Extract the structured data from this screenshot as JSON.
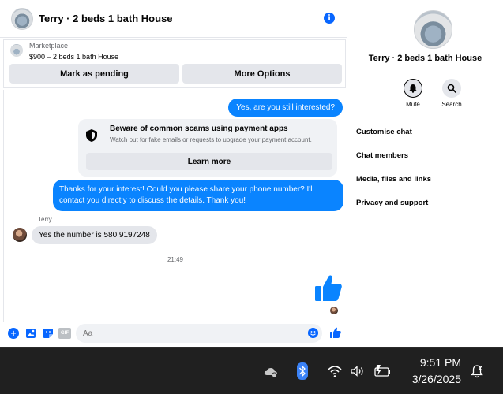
{
  "header": {
    "title": "Terry · 2 beds 1 bath House",
    "info_icon": "info-icon"
  },
  "marketplace": {
    "label": "Marketplace",
    "price_title": "$900 – 2 beds 1 bath House",
    "pending_button": "Mark as pending",
    "more_button": "More Options"
  },
  "messages": {
    "outgoing_1": "Yes, are you still interested?",
    "scam_card": {
      "title": "Beware of common scams using payment apps",
      "description": "Watch out for fake emails or requests to upgrade your payment account.",
      "button": "Learn more",
      "icon": "shield-icon"
    },
    "outgoing_2": "Thanks for your interest! Could you please share your phone number? I'll contact you directly to discuss the details. Thank you!",
    "sender_name": "Terry",
    "incoming_1": "Yes the number is 580 9197248",
    "timestamp": "21:49",
    "big_like_icon": "thumbs-up-icon"
  },
  "composer": {
    "placeholder": "Aa",
    "icons": [
      "plus-icon",
      "photo-icon",
      "sticker-icon",
      "gif-icon",
      "emoji-icon",
      "like-icon"
    ],
    "gif_label": "GIF"
  },
  "sidebar": {
    "title": "Terry · 2 beds 1 bath House",
    "mute_label": "Mute",
    "search_label": "Search",
    "menu": [
      "Customise chat",
      "Chat members",
      "Media, files and links",
      "Privacy and support"
    ]
  },
  "taskbar": {
    "time": "9:51 PM",
    "date": "3/26/2025",
    "icons": [
      "cloud-icon",
      "bluetooth-icon",
      "wifi-icon",
      "volume-icon",
      "battery-icon",
      "notification-icon"
    ]
  },
  "colors": {
    "accent": "#0a84ff",
    "bubble_incoming": "#e4e6eb",
    "taskbar": "#202020"
  }
}
